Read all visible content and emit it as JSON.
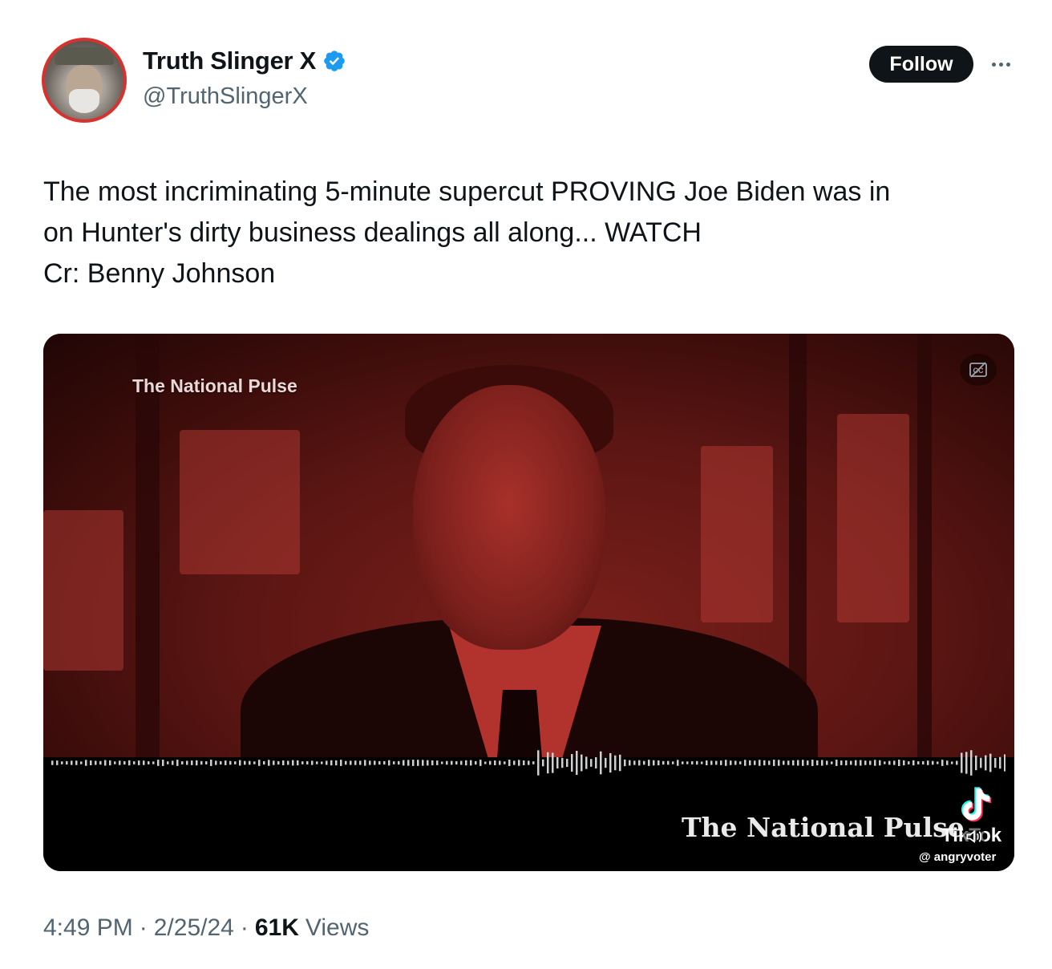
{
  "author": {
    "display_name": "Truth Slinger X",
    "handle": "@TruthSlingerX",
    "verified_color": "#1d9bf0",
    "avatar_ring_color": "#d8322e"
  },
  "actions": {
    "follow_label": "Follow",
    "more_icon": "more-horizontal-icon"
  },
  "tweet": {
    "lines": [
      "The most incriminating 5-minute supercut PROVING Joe Biden was in",
      "on Hunter's dirty business dealings all along... WATCH",
      "Cr: Benny Johnson"
    ]
  },
  "media": {
    "watermark_top": "The National Pulse",
    "watermark_bottom": "The National Pulse.",
    "tiktok_label": "TikTok",
    "tiktok_user": "@ angryvoter",
    "cc_icon": "captions-icon",
    "mute_icon": "volume-icon"
  },
  "meta": {
    "time": "4:49 PM",
    "date": "2/25/24",
    "views_count": "61K",
    "views_label": "Views",
    "separator": "·"
  },
  "colors": {
    "text_primary": "#0f1419",
    "text_secondary": "#536471",
    "follow_bg": "#0f1419"
  }
}
